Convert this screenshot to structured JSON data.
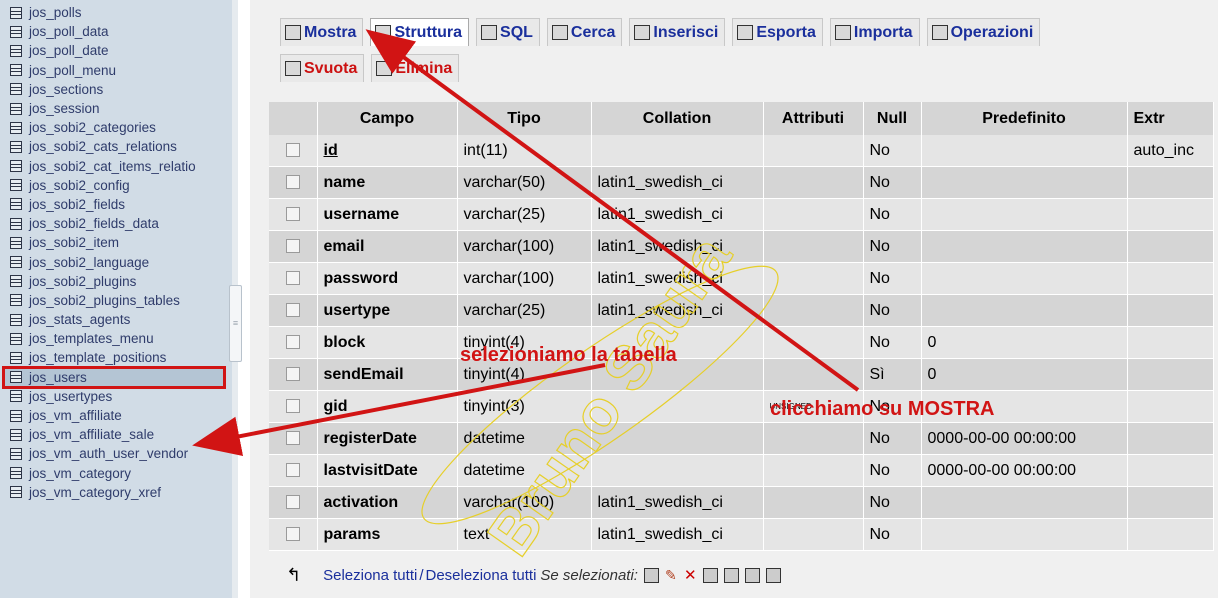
{
  "sidebar": {
    "items": [
      {
        "label": "jos_polls"
      },
      {
        "label": "jos_poll_data"
      },
      {
        "label": "jos_poll_date"
      },
      {
        "label": "jos_poll_menu"
      },
      {
        "label": "jos_sections"
      },
      {
        "label": "jos_session"
      },
      {
        "label": "jos_sobi2_categories"
      },
      {
        "label": "jos_sobi2_cats_relations"
      },
      {
        "label": "jos_sobi2_cat_items_relatio"
      },
      {
        "label": "jos_sobi2_config"
      },
      {
        "label": "jos_sobi2_fields"
      },
      {
        "label": "jos_sobi2_fields_data"
      },
      {
        "label": "jos_sobi2_item"
      },
      {
        "label": "jos_sobi2_language"
      },
      {
        "label": "jos_sobi2_plugins"
      },
      {
        "label": "jos_sobi2_plugins_tables"
      },
      {
        "label": "jos_stats_agents"
      },
      {
        "label": "jos_templates_menu"
      },
      {
        "label": "jos_template_positions"
      },
      {
        "label": "jos_users",
        "selected": true
      },
      {
        "label": "jos_usertypes"
      },
      {
        "label": "jos_vm_affiliate"
      },
      {
        "label": "jos_vm_affiliate_sale"
      },
      {
        "label": "jos_vm_auth_user_vendor"
      },
      {
        "label": "jos_vm_category"
      },
      {
        "label": "jos_vm_category_xref"
      }
    ]
  },
  "tabs": {
    "row1": [
      {
        "label": "Mostra",
        "icon": "browse-icon"
      },
      {
        "label": "Struttura",
        "icon": "structure-icon",
        "active": true
      },
      {
        "label": "SQL",
        "icon": "sql-icon"
      },
      {
        "label": "Cerca",
        "icon": "search-icon"
      },
      {
        "label": "Inserisci",
        "icon": "insert-icon"
      },
      {
        "label": "Esporta",
        "icon": "export-icon"
      },
      {
        "label": "Importa",
        "icon": "import-icon"
      },
      {
        "label": "Operazioni",
        "icon": "operations-icon"
      }
    ],
    "row2": [
      {
        "label": "Svuota",
        "icon": "empty-icon"
      },
      {
        "label": "Elimina",
        "icon": "drop-icon"
      }
    ]
  },
  "table": {
    "headers": [
      "Campo",
      "Tipo",
      "Collation",
      "Attributi",
      "Null",
      "Predefinito",
      "Extr"
    ],
    "rows": [
      {
        "campo": "id",
        "tipo": "int(11)",
        "collation": "",
        "attributi": "",
        "null": "No",
        "predefinito": "",
        "extra": "auto_inc",
        "primary": true
      },
      {
        "campo": "name",
        "tipo": "varchar(50)",
        "collation": "latin1_swedish_ci",
        "attributi": "",
        "null": "No",
        "predefinito": "",
        "extra": ""
      },
      {
        "campo": "username",
        "tipo": "varchar(25)",
        "collation": "latin1_swedish_ci",
        "attributi": "",
        "null": "No",
        "predefinito": "",
        "extra": ""
      },
      {
        "campo": "email",
        "tipo": "varchar(100)",
        "collation": "latin1_swedish_ci",
        "attributi": "",
        "null": "No",
        "predefinito": "",
        "extra": ""
      },
      {
        "campo": "password",
        "tipo": "varchar(100)",
        "collation": "latin1_swedish_ci",
        "attributi": "",
        "null": "No",
        "predefinito": "",
        "extra": ""
      },
      {
        "campo": "usertype",
        "tipo": "varchar(25)",
        "collation": "latin1_swedish_ci",
        "attributi": "",
        "null": "No",
        "predefinito": "",
        "extra": ""
      },
      {
        "campo": "block",
        "tipo": "tinyint(4)",
        "collation": "",
        "attributi": "",
        "null": "No",
        "predefinito": "0",
        "extra": ""
      },
      {
        "campo": "sendEmail",
        "tipo": "tinyint(4)",
        "collation": "",
        "attributi": "",
        "null": "Sì",
        "predefinito": "0",
        "extra": ""
      },
      {
        "campo": "gid",
        "tipo": "tinyint(3)",
        "collation": "",
        "attributi": "UNSIGNED",
        "null": "No",
        "predefinito": "",
        "extra": ""
      },
      {
        "campo": "registerDate",
        "tipo": "datetime",
        "collation": "",
        "attributi": "",
        "null": "No",
        "predefinito": "0000-00-00 00:00:00",
        "extra": ""
      },
      {
        "campo": "lastvisitDate",
        "tipo": "datetime",
        "collation": "",
        "attributi": "",
        "null": "No",
        "predefinito": "0000-00-00 00:00:00",
        "extra": ""
      },
      {
        "campo": "activation",
        "tipo": "varchar(100)",
        "collation": "latin1_swedish_ci",
        "attributi": "",
        "null": "No",
        "predefinito": "",
        "extra": ""
      },
      {
        "campo": "params",
        "tipo": "text",
        "collation": "latin1_swedish_ci",
        "attributi": "",
        "null": "No",
        "predefinito": "",
        "extra": ""
      }
    ]
  },
  "footer": {
    "select_all": "Seleziona tutti",
    "separator": "/",
    "deselect_all": "Deseleziona tutti",
    "with_selected": "Se selezionati:",
    "action_icons": [
      "browse-icon",
      "edit-icon",
      "delete-icon",
      "primary-key-icon",
      "index-icon",
      "unique-icon",
      "fulltext-icon"
    ]
  },
  "annotations": {
    "select_table": "selezioniamo la tabella",
    "click_show": "clicchiamo su MOSTRA",
    "watermark": "Bruno Saura"
  },
  "colors": {
    "annotation_red": "#d11414",
    "link_blue": "#1a2f9c",
    "sidebar_bg": "#d1dce6"
  }
}
